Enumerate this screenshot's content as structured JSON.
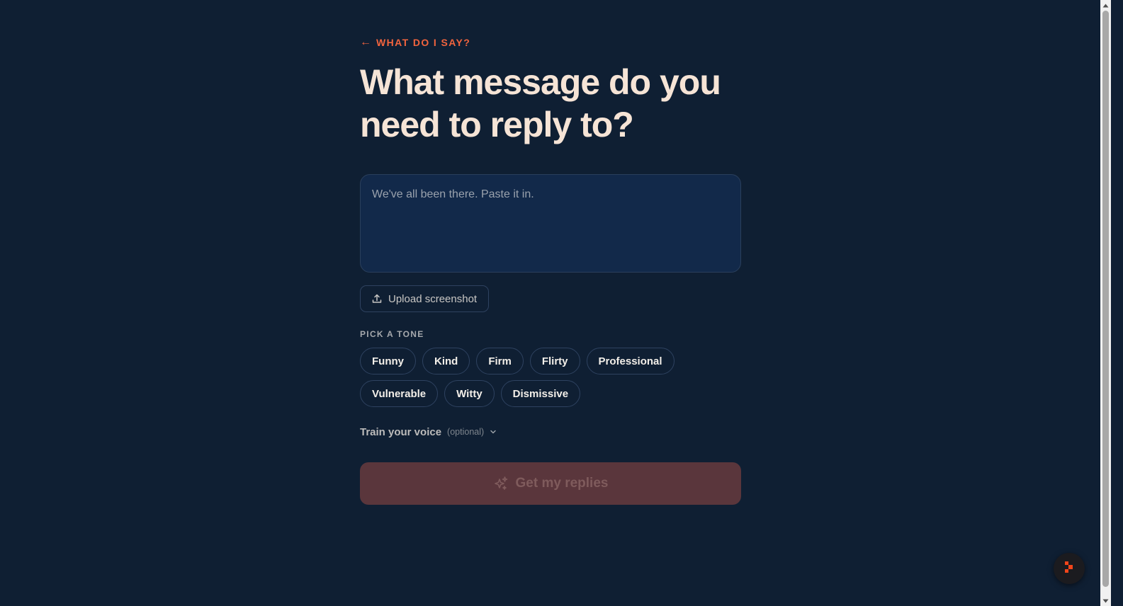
{
  "back_link": {
    "arrow": "←",
    "label": "WHAT DO I SAY?"
  },
  "page_title": "What message do you need to reply to?",
  "message_input": {
    "placeholder": "We've all been there. Paste it in.",
    "value": ""
  },
  "upload_button": {
    "label": "Upload screenshot",
    "icon": "upload-icon"
  },
  "tone_section": {
    "label": "PICK A TONE",
    "tones": [
      {
        "label": "Funny"
      },
      {
        "label": "Kind"
      },
      {
        "label": "Firm"
      },
      {
        "label": "Flirty"
      },
      {
        "label": "Professional"
      },
      {
        "label": "Vulnerable"
      },
      {
        "label": "Witty"
      },
      {
        "label": "Dismissive"
      }
    ]
  },
  "train_voice": {
    "label": "Train your voice",
    "optional_label": "(optional)",
    "icon": "chevron-down-icon"
  },
  "submit_button": {
    "label": "Get my replies",
    "icon": "sparkles-icon",
    "disabled": true
  },
  "fab": {
    "icon": "app-logo-icon"
  },
  "colors": {
    "background": "#0f1f33",
    "accent": "#f2643e",
    "title": "#f6e4d6",
    "input_bg": "#12294a",
    "submit_disabled_bg": "#5a363c"
  }
}
